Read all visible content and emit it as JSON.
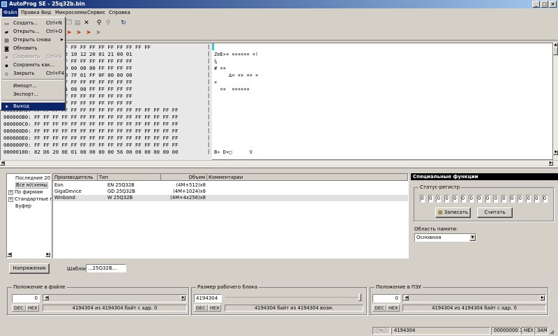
{
  "title": "AutoProg SE - 25q32b.bin",
  "window_buttons": {
    "minimize": "_",
    "maximize": "□",
    "close": "×"
  },
  "menu": [
    "Файл",
    "Правка",
    "Вид",
    "Микросхема",
    "Сервис",
    "Справка"
  ],
  "file_menu": [
    {
      "label": "Создать...",
      "shortcut": "Ctrl+N",
      "icon": "new-file-icon",
      "glyph": "▭",
      "state": "normal"
    },
    {
      "label": "Открыть...",
      "shortcut": "Ctrl+O",
      "icon": "open-folder-icon",
      "glyph": "▰",
      "state": "normal"
    },
    {
      "label": "Открыть снова",
      "shortcut": "",
      "icon": "reopen-icon",
      "glyph": "▤",
      "state": "submenu"
    },
    {
      "label": "Обновить",
      "shortcut": "",
      "icon": "refresh-icon",
      "glyph": "◙",
      "state": "normal"
    },
    {
      "label": "Сохранить",
      "shortcut": "Ctrl+S",
      "icon": "save-icon",
      "glyph": "▪",
      "state": "disabled"
    },
    {
      "label": "Сохранить как...",
      "shortcut": "",
      "icon": "save-as-icon",
      "glyph": "▪",
      "state": "normal"
    },
    {
      "label": "Закрыть",
      "shortcut": "Ctrl+F4",
      "icon": "close-file-icon",
      "glyph": "▫",
      "state": "normal"
    },
    {
      "label": "Импорт...",
      "shortcut": "",
      "icon": "",
      "glyph": "",
      "state": "normal"
    },
    {
      "label": "Экспорт...",
      "shortcut": "",
      "icon": "",
      "glyph": "",
      "state": "normal"
    },
    {
      "label": "Выход",
      "shortcut": "",
      "icon": "exit-icon",
      "glyph": "✶",
      "state": "highlighted"
    }
  ],
  "hex_rows": [
    {
      "addr": "",
      "bytes": "FF FF FF FF FF FF FF FF FF FF FF FF FF FF FF FF",
      "ascii": ""
    },
    {
      "addr": "",
      "bytes": "0F 03 00 04 02 06 02 10 12 20 01 21 00 01",
      "ascii": "ZeE»¤ ¤¤¤¤¤¤ ¤!"
    },
    {
      "addr": "",
      "bytes": "00 FF FF FF FF FF FF FF FF FF FF FF FF FF",
      "ascii": "¼"
    },
    {
      "addr": "",
      "bytes": "09 00 00 00 00 00 00 00 00 00 FF FF FF FF",
      "ascii": "# ¤¤"
    },
    {
      "addr": "",
      "bytes": "00 80 01 FF 03 01 00 7F 01 FF 0F 00 00 00",
      "ascii": "     ∆¤ ¤¤ ¤¤ ×"
    },
    {
      "addr": "",
      "bytes": "00 FF FF FF FF FF FF FF FF FF FF FF FF FF",
      "ascii": "×"
    },
    {
      "addr": "",
      "bytes": "0A 00 00 00 0C 18 01 08 08 FF FF FF FF FF",
      "ascii": "  ¤¤  ¤¤¤¤¤¤"
    },
    {
      "addr": "",
      "bytes": "FF FF FF FF FF FF FF FF FF FF FF FF FF FF",
      "ascii": ""
    },
    {
      "addr": "",
      "bytes": "FF FF FF FF FF FF FF FF FF FF FF FF FF FF",
      "ascii": ""
    },
    {
      "addr": "000000A0:",
      "bytes": "FF FF FF FF FF FF FF FF FF FF FF FF FF FF FF FF",
      "ascii": ""
    },
    {
      "addr": "000000B0:",
      "bytes": "FF FF FF FF FF FF FF FF FF FF FF FF FF FF FF FF",
      "ascii": ""
    },
    {
      "addr": "000000C0:",
      "bytes": "FF FF FF FF FF FF FF FF FF FF FF FF FF FF FF FF",
      "ascii": ""
    },
    {
      "addr": "000000D0:",
      "bytes": "FF FF FF FF FF FF FF FF FF FF FF FF FF FF FF FF",
      "ascii": ""
    },
    {
      "addr": "000000E0:",
      "bytes": "FF FF FF FF FF FF FF FF FF FF FF FF FF FF FF FF",
      "ascii": ""
    },
    {
      "addr": "000000F0:",
      "bytes": "FF FF FF FF FF FF FF FF FF FF FF FF FF FF FF FF",
      "ascii": ""
    },
    {
      "addr": "00000100:",
      "bytes": "82 D6 20 0E 01 00 00 00 00 56 00 00 00 00 00 00",
      "ascii": "B» D×□      V"
    }
  ],
  "tree": [
    {
      "label": "Последние 20",
      "expandable": false,
      "selected": false
    },
    {
      "label": "Все м/схемы",
      "expandable": false,
      "selected": true
    },
    {
      "label": "По фирмам",
      "expandable": true,
      "selected": false
    },
    {
      "label": "Стандартные г",
      "expandable": true,
      "selected": false
    },
    {
      "label": "Буфер",
      "expandable": false,
      "selected": false
    }
  ],
  "list_headers": [
    "Производитель",
    "Тип",
    "Объем",
    "Комментарии"
  ],
  "list_rows": [
    {
      "maker": "Eon",
      "type": "EN 25Q32B",
      "size": "(4M+512)x8",
      "comment": "",
      "selected": false
    },
    {
      "maker": "GigaDevice",
      "type": "GD 25Q32B",
      "size": "(4M+1024)x8",
      "comment": "",
      "selected": false
    },
    {
      "maker": "Winbond",
      "type": "W 25Q32B",
      "size": "(4M+4x256)x8",
      "comment": "",
      "selected": true
    }
  ],
  "voltage_button": "Напряжения",
  "template_label": "Шаблон",
  "template_value": "...25Q32B...",
  "special": {
    "title": "Специальные функции",
    "status_group": "Статус-регистр",
    "bits": [
      "0",
      "0",
      "0",
      "0",
      "0",
      "0",
      "0",
      "0",
      "0",
      "0",
      "0",
      "0",
      "0",
      "0",
      "0",
      "0"
    ],
    "write_button": "Записать",
    "read_button": "Считать",
    "memory_label": "Область памяти:",
    "memory_value": "Основная"
  },
  "file_pos": {
    "title": "Положение в файле",
    "value": "0",
    "dec": "DEC",
    "hex": "HEX",
    "info": "4194304 из 4194304 байт с адр. 0",
    "progress": 0.0
  },
  "block_size": {
    "title": "Размер рабочего блока",
    "value": "4194304",
    "dec": "DEC",
    "hex": "HEX",
    "info": "4194304 байт из 4194304 возм.",
    "slider": 1.0
  },
  "rom_pos": {
    "title": "Положение в ПЗУ",
    "value": "0",
    "dec": "DEC",
    "hex": "HEX",
    "info": "4194304 из 4194304 байт с адр. 0",
    "progress": 0.0
  },
  "status": {
    "size": "4194304",
    "address": "00000000:1",
    "mode": "HEX",
    "ins": "ЗАМ"
  },
  "colors": {
    "title_start": "#0a246a",
    "title_end": "#a6caf0",
    "highlight": "#0a246a",
    "cursor": "#33cccc"
  }
}
